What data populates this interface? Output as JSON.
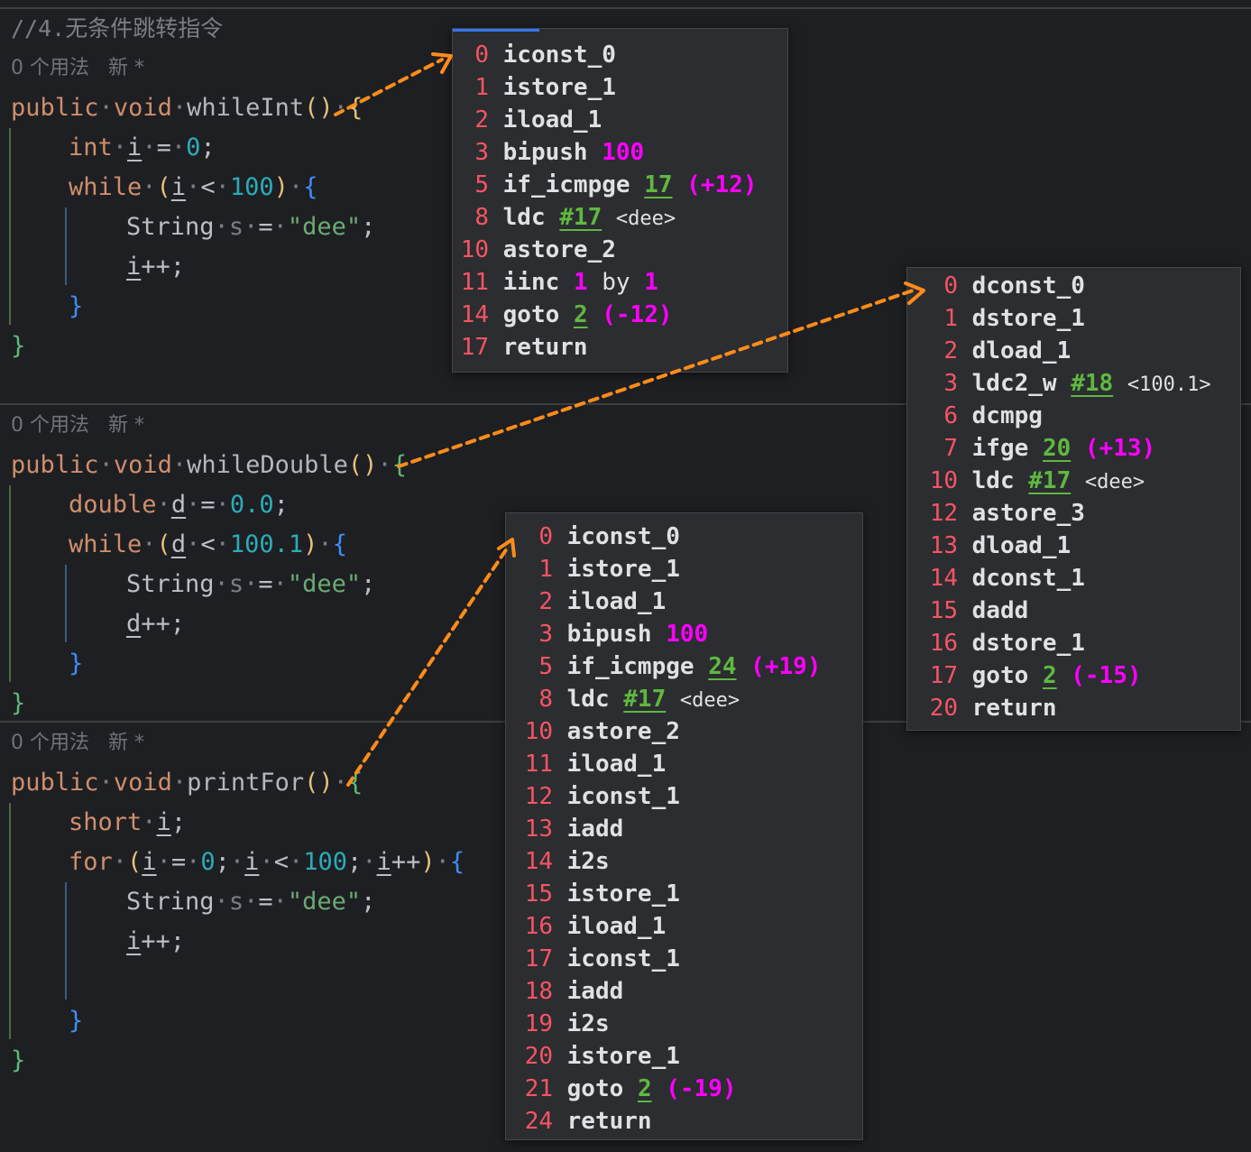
{
  "colors": {
    "arrow": "#ff8c1a",
    "bytecode_index": "#f75464",
    "keyword": "#cf8e6d",
    "number": "#2aacb8",
    "string": "#6aab73",
    "magenta": "#ff00ff",
    "green_ref": "#5fb840"
  },
  "comment": "//4.无条件跳转指令",
  "meta": {
    "usages": "0 个用法",
    "new": "新 *"
  },
  "methods": [
    {
      "sig": {
        "public": "public",
        "void": "void",
        "name": "whileInt",
        "parens": "()",
        "brace": "{"
      },
      "decl": {
        "type": "int",
        "var": "i",
        "eq": "=",
        "val": "0",
        "semi": ";"
      },
      "loop": {
        "kw": "while",
        "open": "(",
        "var": "i",
        "op": "<",
        "limit": "100",
        "close": ")",
        "brace": "{"
      },
      "body1": {
        "type": "String",
        "var": "s",
        "eq": "=",
        "str": "\"dee\"",
        "semi": ";"
      },
      "body2": {
        "var": "i",
        "rest": "++;"
      },
      "inner_close": "}",
      "outer_close": "}"
    },
    {
      "sig": {
        "public": "public",
        "void": "void",
        "name": "whileDouble",
        "parens": "()",
        "brace": "{"
      },
      "decl": {
        "type": "double",
        "var": "d",
        "eq": "=",
        "val": "0.0",
        "semi": ";"
      },
      "loop": {
        "kw": "while",
        "open": "(",
        "var": "d",
        "op": "<",
        "limit": "100.1",
        "close": ")",
        "brace": "{"
      },
      "body1": {
        "type": "String",
        "var": "s",
        "eq": "=",
        "str": "\"dee\"",
        "semi": ";"
      },
      "body2": {
        "var": "d",
        "rest": "++;"
      },
      "inner_close": "}",
      "outer_close": "}"
    },
    {
      "sig": {
        "public": "public",
        "void": "void",
        "name": "printFor",
        "parens": "()",
        "brace": "{"
      },
      "decl": {
        "type": "short",
        "var": "i",
        "semi": ";"
      },
      "loop": {
        "kw": "for",
        "open": "(",
        "var": "i",
        "eq": "=",
        "init": "0",
        "semi1": ";",
        "var2": "i",
        "op": "<",
        "limit": "100",
        "semi2": ";",
        "var3": "i",
        "inc": "++",
        "close": ")",
        "brace": "{"
      },
      "body1": {
        "type": "String",
        "var": "s",
        "eq": "=",
        "str": "\"dee\"",
        "semi": ";"
      },
      "body2": {
        "var": "i",
        "rest": "++;"
      },
      "inner_close": "}",
      "outer_close": "}"
    }
  ],
  "popups": [
    {
      "rows": [
        {
          "i": "0",
          "op": "iconst_0"
        },
        {
          "i": "1",
          "op": "istore_1"
        },
        {
          "i": "2",
          "op": "iload_1"
        },
        {
          "i": "3",
          "op": "bipush",
          "a1": "100",
          "a1c": "mag"
        },
        {
          "i": "5",
          "op": "if_icmpge",
          "a1": "17",
          "a1c": "grn",
          "a2": "(+12)",
          "a2c": "mag"
        },
        {
          "i": "8",
          "op": "ldc",
          "a1": "#17",
          "a1c": "grn",
          "a2": "<dee>",
          "a2c": "cm"
        },
        {
          "i": "10",
          "op": "astore_2"
        },
        {
          "i": "11",
          "op": "iinc",
          "a1": "1",
          "a1c": "mag",
          "a2": "by",
          "a2c": "plain",
          "a3": "1",
          "a3c": "mag"
        },
        {
          "i": "14",
          "op": "goto",
          "a1": "2",
          "a1c": "grn",
          "a2": "(-12)",
          "a2c": "mag"
        },
        {
          "i": "17",
          "op": "return"
        }
      ]
    },
    {
      "rows": [
        {
          "i": "0",
          "op": "dconst_0"
        },
        {
          "i": "1",
          "op": "dstore_1"
        },
        {
          "i": "2",
          "op": "dload_1"
        },
        {
          "i": "3",
          "op": "ldc2_w",
          "a1": "#18",
          "a1c": "grn",
          "a2": "<100.1>",
          "a2c": "cm"
        },
        {
          "i": "6",
          "op": "dcmpg"
        },
        {
          "i": "7",
          "op": "ifge",
          "a1": "20",
          "a1c": "grn",
          "a2": "(+13)",
          "a2c": "mag"
        },
        {
          "i": "10",
          "op": "ldc",
          "a1": "#17",
          "a1c": "grn",
          "a2": "<dee>",
          "a2c": "cm"
        },
        {
          "i": "12",
          "op": "astore_3"
        },
        {
          "i": "13",
          "op": "dload_1"
        },
        {
          "i": "14",
          "op": "dconst_1"
        },
        {
          "i": "15",
          "op": "dadd"
        },
        {
          "i": "16",
          "op": "dstore_1"
        },
        {
          "i": "17",
          "op": "goto",
          "a1": "2",
          "a1c": "grn",
          "a2": "(-15)",
          "a2c": "mag"
        },
        {
          "i": "20",
          "op": "return"
        }
      ]
    },
    {
      "rows": [
        {
          "i": "0",
          "op": "iconst_0"
        },
        {
          "i": "1",
          "op": "istore_1"
        },
        {
          "i": "2",
          "op": "iload_1"
        },
        {
          "i": "3",
          "op": "bipush",
          "a1": "100",
          "a1c": "mag"
        },
        {
          "i": "5",
          "op": "if_icmpge",
          "a1": "24",
          "a1c": "grn",
          "a2": "(+19)",
          "a2c": "mag"
        },
        {
          "i": "8",
          "op": "ldc",
          "a1": "#17",
          "a1c": "grn",
          "a2": "<dee>",
          "a2c": "cm"
        },
        {
          "i": "10",
          "op": "astore_2"
        },
        {
          "i": "11",
          "op": "iload_1"
        },
        {
          "i": "12",
          "op": "iconst_1"
        },
        {
          "i": "13",
          "op": "iadd"
        },
        {
          "i": "14",
          "op": "i2s"
        },
        {
          "i": "15",
          "op": "istore_1"
        },
        {
          "i": "16",
          "op": "iload_1"
        },
        {
          "i": "17",
          "op": "iconst_1"
        },
        {
          "i": "18",
          "op": "iadd"
        },
        {
          "i": "19",
          "op": "i2s"
        },
        {
          "i": "20",
          "op": "istore_1"
        },
        {
          "i": "21",
          "op": "goto",
          "a1": "2",
          "a1c": "grn",
          "a2": "(-19)",
          "a2c": "mag"
        },
        {
          "i": "24",
          "op": "return"
        }
      ]
    }
  ]
}
